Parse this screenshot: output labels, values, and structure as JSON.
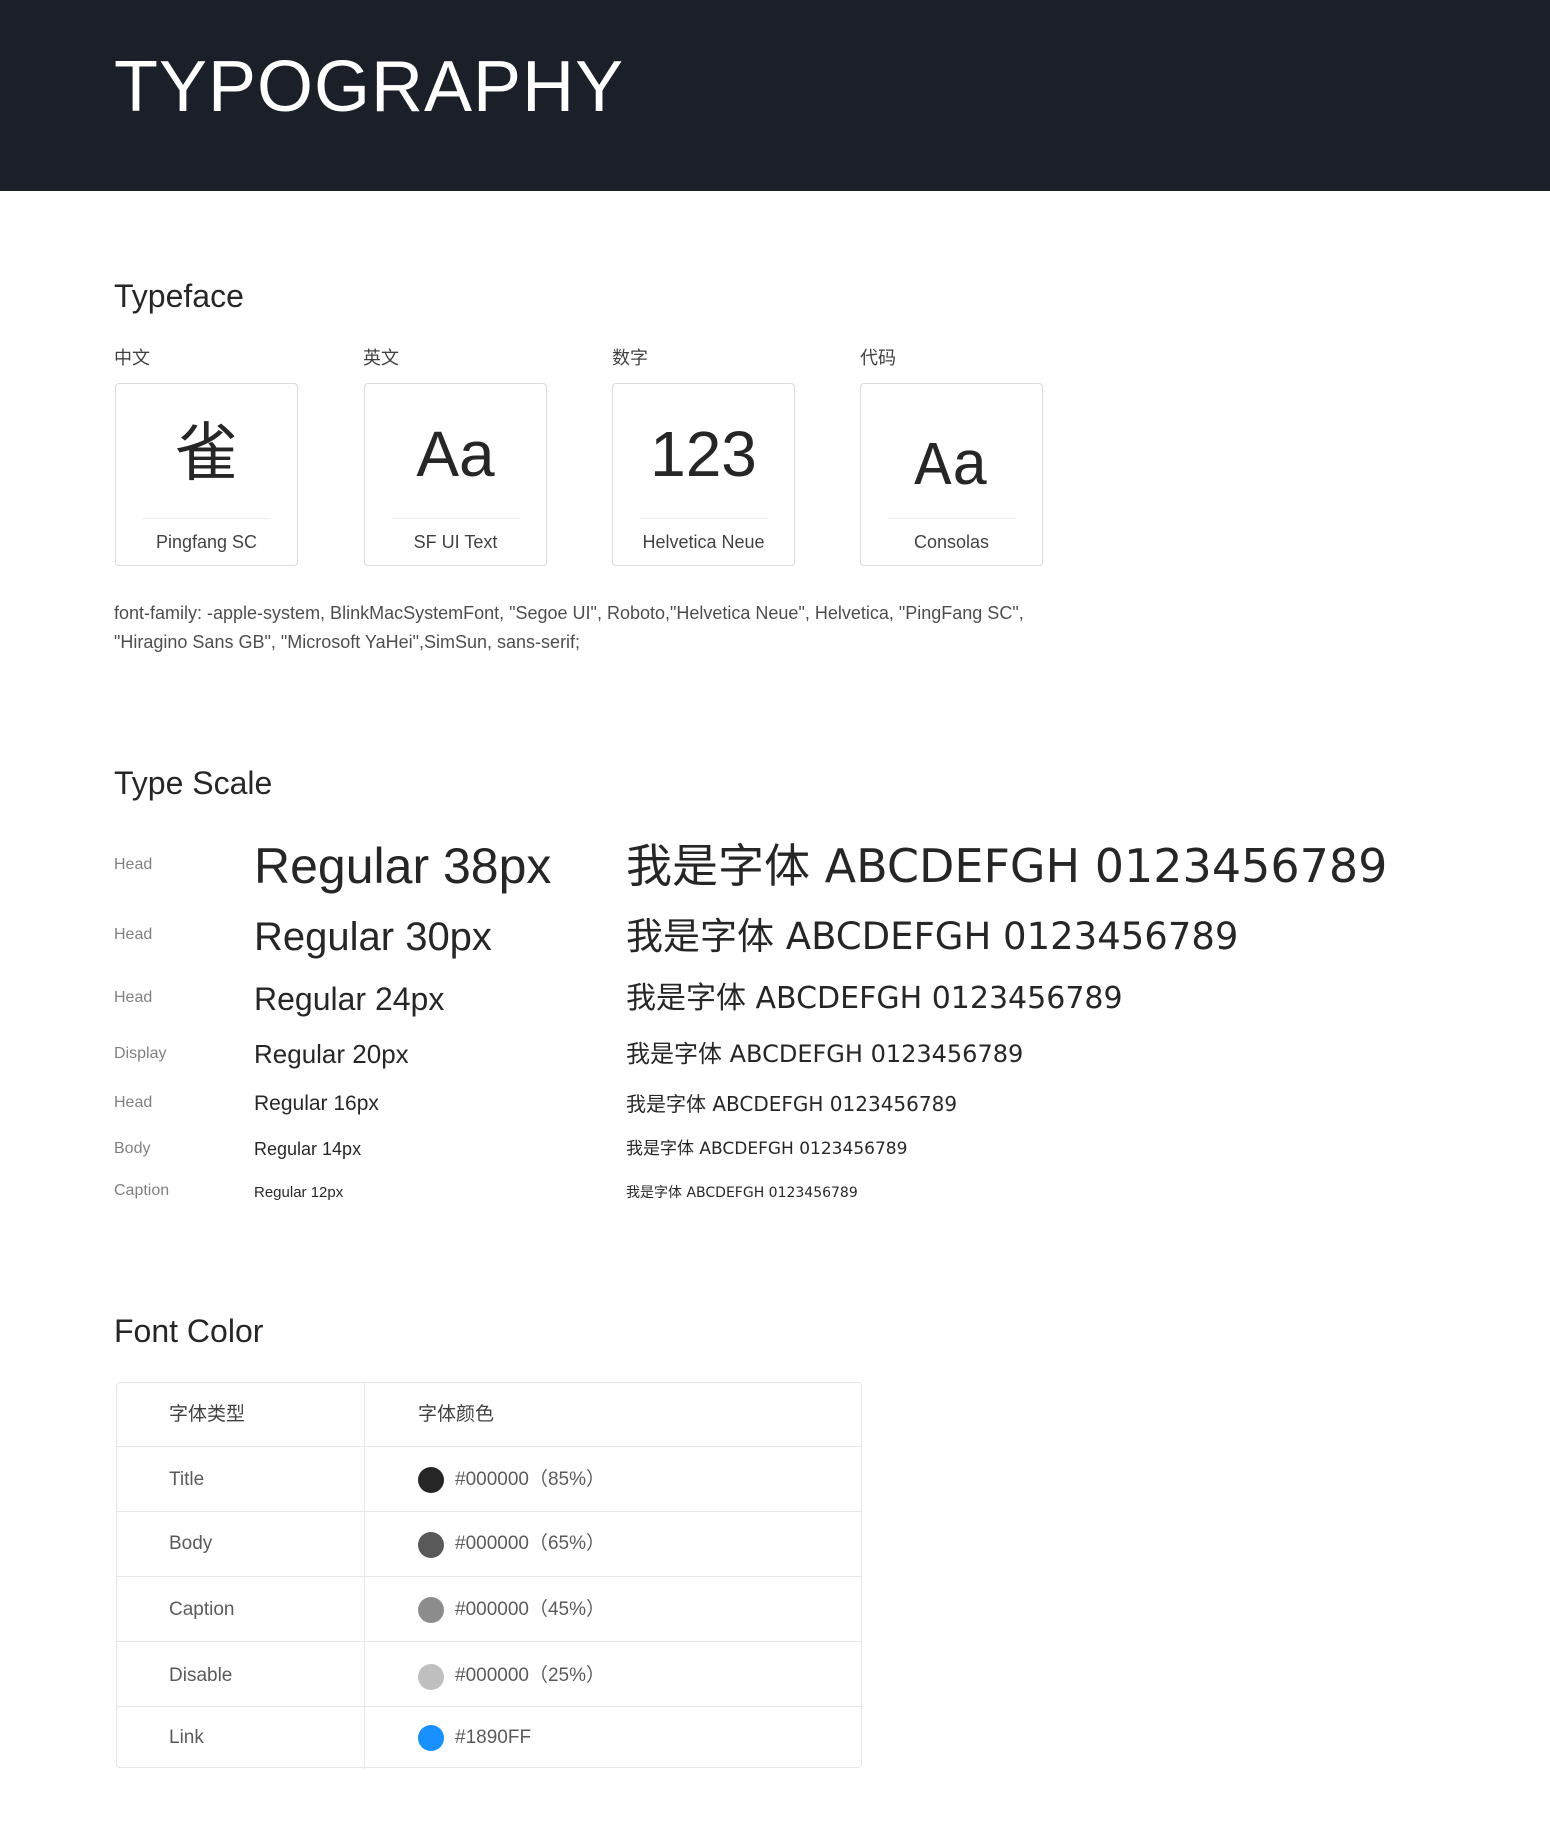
{
  "header": {
    "title": "TYPOGRAPHY"
  },
  "typeface": {
    "title": "Typeface",
    "cards": [
      {
        "label": "中文",
        "glyph": "雀",
        "font_name": "Pingfang SC"
      },
      {
        "label": "英文",
        "glyph": "Aa",
        "font_name": "SF UI Text"
      },
      {
        "label": "数字",
        "glyph": "123",
        "font_name": "Helvetica Neue"
      },
      {
        "label": "代码",
        "glyph": "Aa",
        "font_name": "Consolas"
      }
    ],
    "font_family_note": "font-family: -apple-system, BlinkMacSystemFont, \"Segoe UI\", Roboto,\"Helvetica Neue\", Helvetica, \"PingFang SC\", \"Hiragino Sans GB\", \"Microsoft YaHei\",SimSun, sans-serif;"
  },
  "type_scale": {
    "title": "Type Scale",
    "rows": [
      {
        "label": "Head",
        "name": "Regular 38px",
        "sample": "我是字体 ABCDEFGH 0123456789"
      },
      {
        "label": "Head",
        "name": "Regular 30px",
        "sample": "我是字体 ABCDEFGH 0123456789"
      },
      {
        "label": "Head",
        "name": "Regular 24px",
        "sample": "我是字体 ABCDEFGH 0123456789"
      },
      {
        "label": "Display",
        "name": "Regular 20px",
        "sample": "我是字体 ABCDEFGH 0123456789"
      },
      {
        "label": "Head",
        "name": "Regular 16px",
        "sample": "我是字体 ABCDEFGH 0123456789"
      },
      {
        "label": "Body",
        "name": "Regular 14px",
        "sample": "我是字体 ABCDEFGH 0123456789"
      },
      {
        "label": "Caption",
        "name": "Regular 12px",
        "sample": "我是字体 ABCDEFGH 0123456789"
      }
    ]
  },
  "font_color": {
    "title": "Font Color",
    "headers": {
      "type": "字体类型",
      "color": "字体颜色"
    },
    "rows": [
      {
        "type": "Title",
        "value": "#000000（85%）",
        "swatch": "#262626"
      },
      {
        "type": "Body",
        "value": "#000000（65%）",
        "swatch": "#595959"
      },
      {
        "type": "Caption",
        "value": "#000000（45%）",
        "swatch": "#8c8c8c"
      },
      {
        "type": "Disable",
        "value": "#000000（25%）",
        "swatch": "#bfbfbf"
      },
      {
        "type": "Link",
        "value": "#1890FF",
        "swatch": "#1890FF"
      }
    ]
  }
}
